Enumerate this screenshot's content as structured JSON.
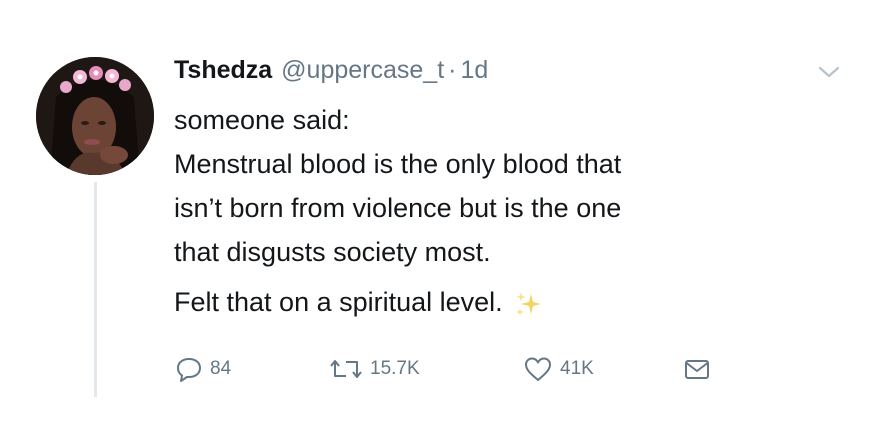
{
  "tweet": {
    "author_name": "Tshedza",
    "handle": "@uppercase_t",
    "separator": "·",
    "time": "1d",
    "lines": [
      "someone said:",
      "Menstrual blood is the only blood that",
      "isn’t born from violence but is the one",
      "that disgusts society most."
    ],
    "closing_line": "Felt that on a spiritual level.",
    "closing_emoji": "sparkles-icon"
  },
  "actions": {
    "replies": "84",
    "retweets": "15.7K",
    "likes": "41K"
  },
  "colors": {
    "text": "#14171a",
    "secondary": "#657786",
    "thread_line": "#e3e8ec",
    "sparkle": "#f4d35e"
  }
}
